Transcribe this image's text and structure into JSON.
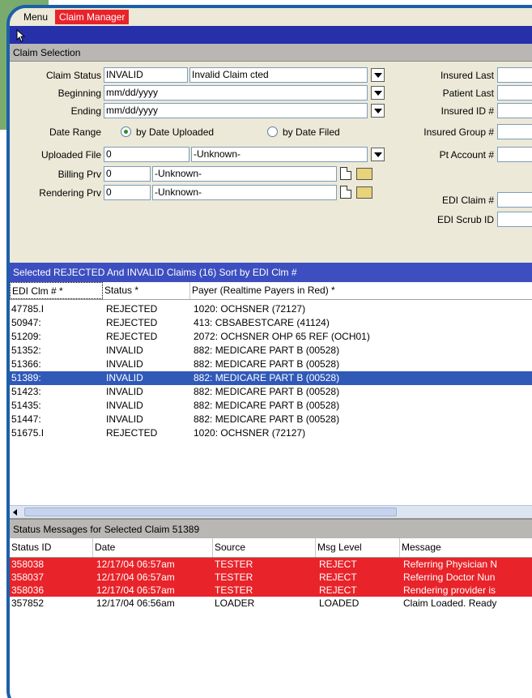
{
  "menubar": {
    "menu": "Menu",
    "active": "Claim Manager"
  },
  "claim_selection": {
    "title": "Claim Selection",
    "claim_status_label": "Claim Status",
    "claim_status_value": "INVALID",
    "claim_status_desc": "Invalid Claim cted",
    "beginning_label": "Beginning",
    "beginning_value": "mm/dd/yyyy",
    "ending_label": "Ending",
    "ending_value": "mm/dd/yyyy",
    "date_range_label": "Date Range",
    "radio_uploaded": "by Date Uploaded",
    "radio_filed": "by Date Filed",
    "uploaded_file_label": "Uploaded File",
    "uploaded_file_value": "0",
    "uploaded_file_desc": "-Unknown-",
    "billing_prv_label": "Billing Prv",
    "billing_prv_value": "0",
    "billing_prv_desc": "-Unknown-",
    "rendering_prv_label": "Rendering Prv",
    "rendering_prv_value": "0",
    "rendering_prv_desc": "-Unknown-",
    "insured_last_label": "Insured Last",
    "patient_last_label": "Patient Last",
    "insured_id_label": "Insured ID #",
    "insured_group_label": "Insured Group #",
    "pt_account_label": "Pt Account #",
    "edi_claim_label": "EDI Claim #",
    "edi_scrub_label": "EDI Scrub ID"
  },
  "claims_list": {
    "header": "Selected REJECTED And INVALID Claims  (16) Sort by EDI Clm #",
    "columns": [
      "EDI Clm # *",
      "Status *",
      "Payer (Realtime Payers in Red) *"
    ],
    "rows": [
      {
        "id": "47785.I",
        "status": "REJECTED",
        "payer": "1020: OCHSNER (72127)"
      },
      {
        "id": "50947:",
        "status": "REJECTED",
        "payer": "413: CBSABESTCARE (41124)"
      },
      {
        "id": "51209:",
        "status": "REJECTED",
        "payer": "2072: OCHSNER OHP 65 REF (OCH01)"
      },
      {
        "id": "51352:",
        "status": "INVALID",
        "payer": "882: MEDICARE  PART B (00528)"
      },
      {
        "id": "51366:",
        "status": "INVALID",
        "payer": "882: MEDICARE  PART B (00528)"
      },
      {
        "id": "51389:",
        "status": "INVALID",
        "payer": "882: MEDICARE  PART B (00528)"
      },
      {
        "id": "51423:",
        "status": "INVALID",
        "payer": "882: MEDICARE  PART B (00528)"
      },
      {
        "id": "51435:",
        "status": "INVALID",
        "payer": "882: MEDICARE  PART B (00528)"
      },
      {
        "id": "51447:",
        "status": "INVALID",
        "payer": "882: MEDICARE  PART B (00528)"
      },
      {
        "id": "51675.I",
        "status": "REJECTED",
        "payer": "1020: OCHSNER (72127)"
      }
    ]
  },
  "status_messages": {
    "title": "Status Messages for Selected Claim 51389",
    "columns": [
      "Status ID",
      "Date",
      "Source",
      "Msg Level",
      "Message"
    ],
    "rows": [
      {
        "sid": "358038",
        "date": "12/17/04 06:57am",
        "source": "TESTER",
        "level": "REJECT",
        "message": "Referring Physician N"
      },
      {
        "sid": "358037",
        "date": "12/17/04 06:57am",
        "source": "TESTER",
        "level": "REJECT",
        "message": "Referring Doctor Nun"
      },
      {
        "sid": "358036",
        "date": "12/17/04 06:57am",
        "source": "TESTER",
        "level": "REJECT",
        "message": "Rendering provider is"
      },
      {
        "sid": "357852",
        "date": "12/17/04 06:56am",
        "source": "LOADER",
        "level": "LOADED",
        "message": "Claim Loaded. Ready"
      }
    ]
  },
  "colors": {
    "accent_blue": "#2630a8",
    "reject_red": "#e8232a",
    "selection_blue": "#3059b8",
    "frame_blue": "#1c5fa8",
    "green_panel": "#7aab6e"
  }
}
